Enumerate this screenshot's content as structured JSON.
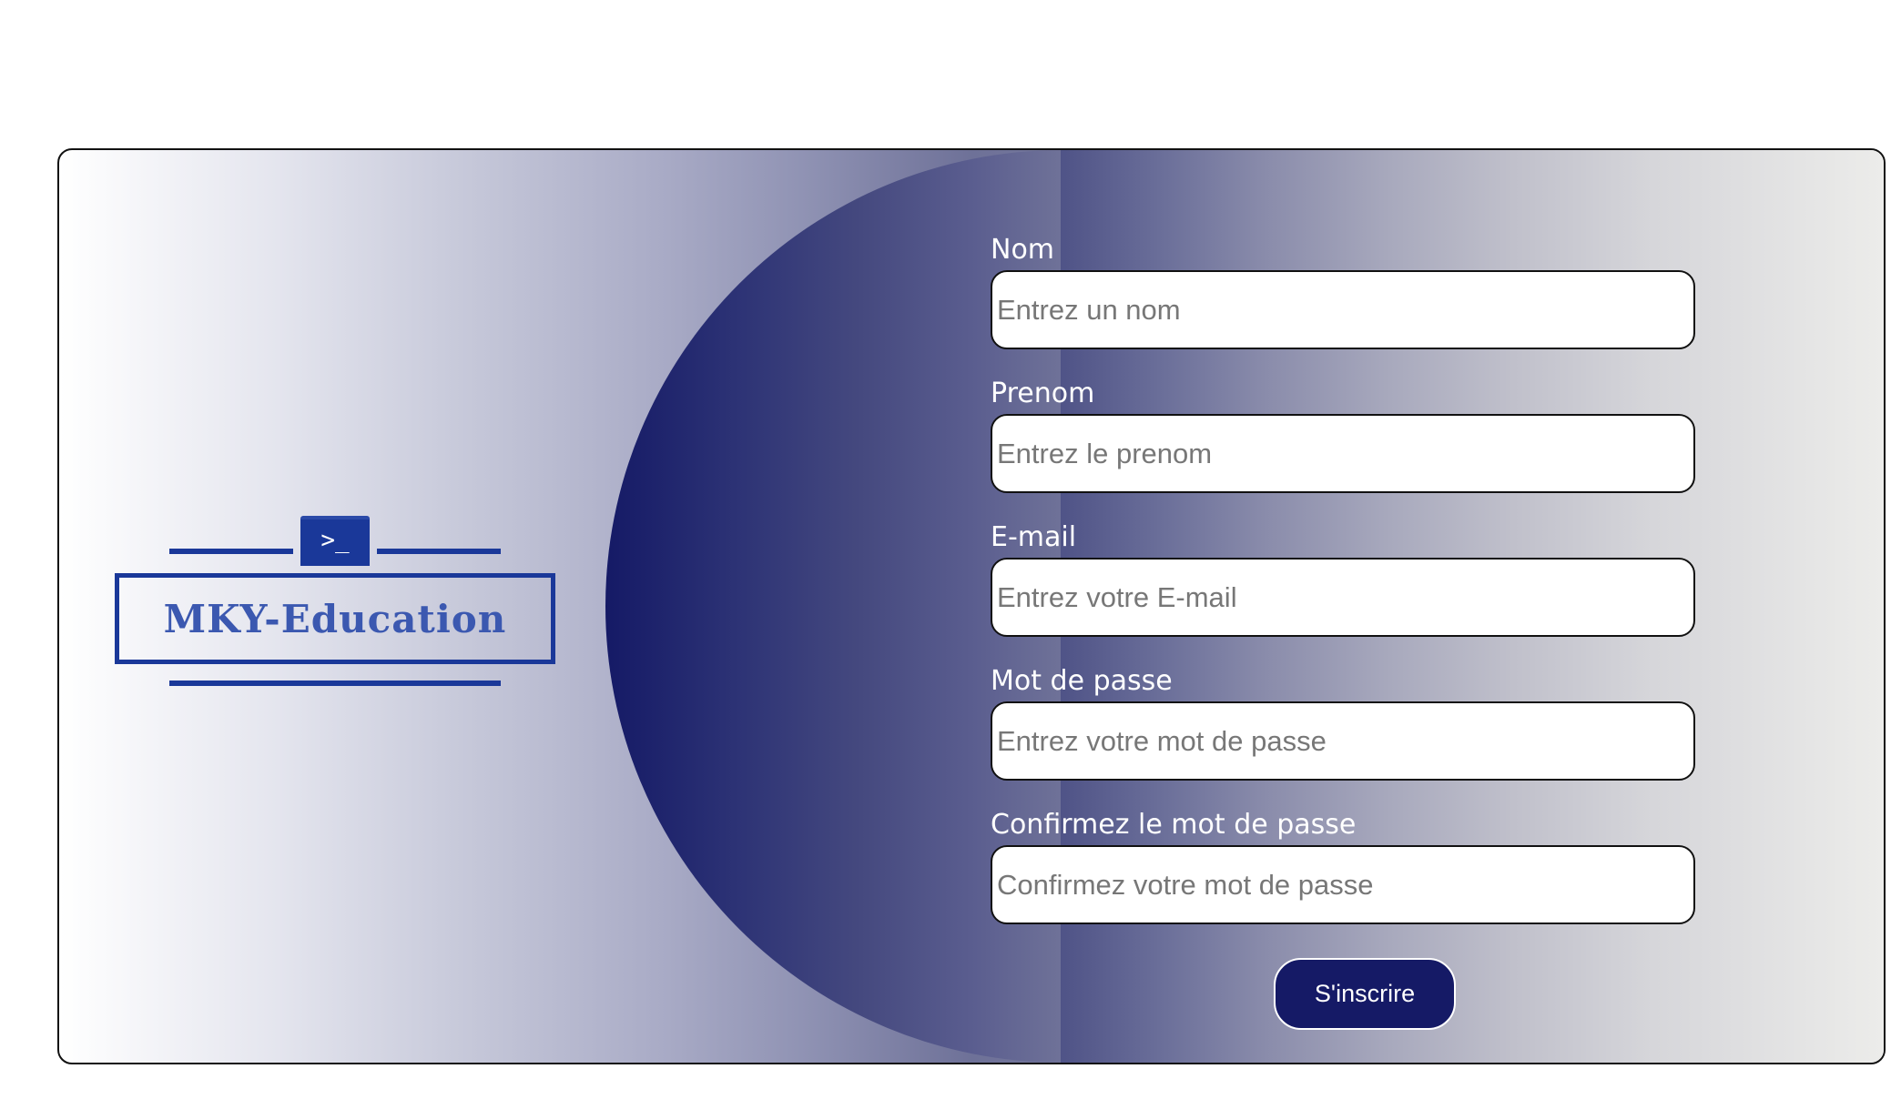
{
  "logo": {
    "icon_glyph": ">_",
    "text": "MKY-Education",
    "color": "#1a3899"
  },
  "form": {
    "fields": [
      {
        "label": "Nom",
        "placeholder": "Entrez un nom",
        "value": ""
      },
      {
        "label": "Prenom",
        "placeholder": "Entrez le prenom",
        "value": ""
      },
      {
        "label": "E-mail",
        "placeholder": "Entrez votre E-mail",
        "value": ""
      },
      {
        "label": "Mot de passe",
        "placeholder": "Entrez votre mot de passe",
        "value": ""
      },
      {
        "label": "Confirmez le mot de passe",
        "placeholder": "Confirmez votre mot de passe",
        "value": ""
      }
    ],
    "submit_label": "S'inscrire"
  },
  "colors": {
    "accent": "#151a66",
    "card_border": "#111111"
  }
}
